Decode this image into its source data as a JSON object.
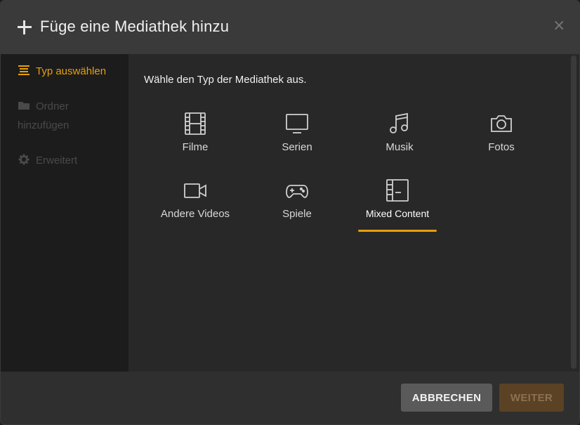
{
  "dialog": {
    "title": "Füge eine Mediathek hinzu",
    "close_label": "×"
  },
  "sidebar": {
    "items": [
      {
        "label": "Typ auswählen",
        "icon": "list-icon",
        "state": "active"
      },
      {
        "label": "Ordner hinzufügen",
        "icon": "folder-icon",
        "state": "disabled"
      },
      {
        "label": "Erweitert",
        "icon": "gear-icon",
        "state": "disabled"
      }
    ]
  },
  "main": {
    "prompt": "Wähle den Typ der Mediathek aus.",
    "types": [
      {
        "label": "Filme",
        "icon": "film-icon"
      },
      {
        "label": "Serien",
        "icon": "tv-icon"
      },
      {
        "label": "Musik",
        "icon": "music-note-icon"
      },
      {
        "label": "Fotos",
        "icon": "camera-icon"
      },
      {
        "label": "Andere Videos",
        "icon": "video-camera-icon"
      },
      {
        "label": "Spiele",
        "icon": "gamepad-icon"
      },
      {
        "label": "Mixed Content",
        "icon": "mixed-content-icon",
        "selected": true
      }
    ]
  },
  "footer": {
    "cancel_label": "ABBRECHEN",
    "next_label": "WEITER"
  },
  "colors": {
    "accent": "#e5a00d",
    "background": "#282828",
    "header": "#3a3a3a",
    "sidebar": "#1c1c1c"
  }
}
